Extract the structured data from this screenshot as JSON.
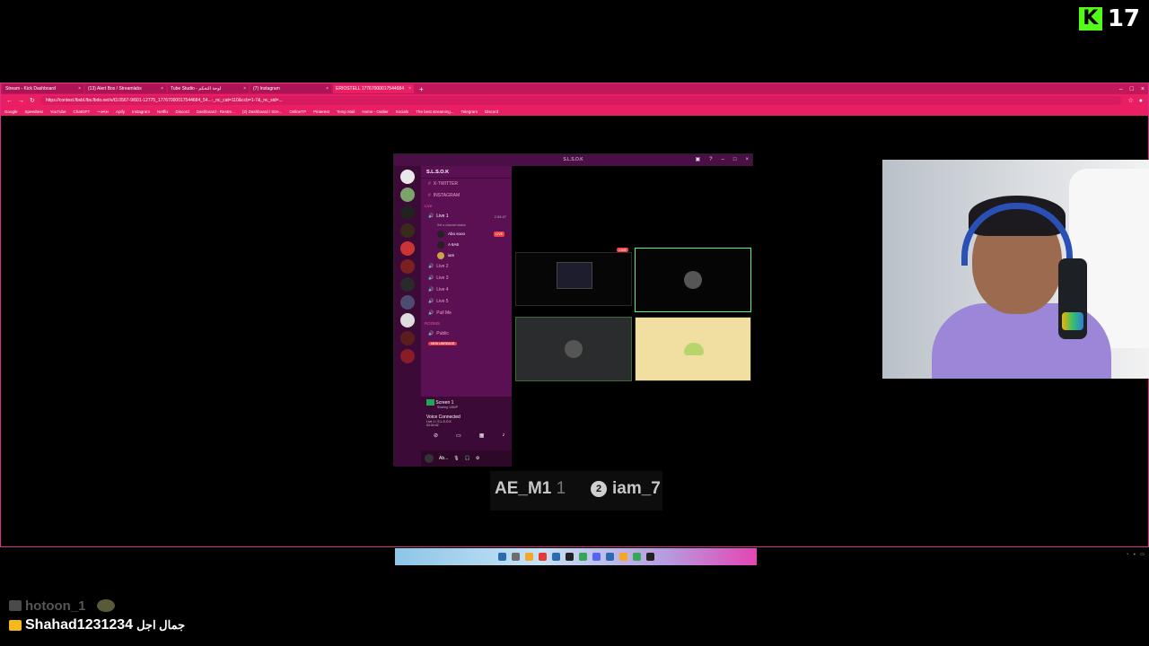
{
  "kick": {
    "logo": "K",
    "viewer_count": "17",
    "brand_color": "#53fc18"
  },
  "browser": {
    "tabs": [
      {
        "label": "Stream - Kick Dashboard",
        "active": false
      },
      {
        "label": "(13) Alert Box / Streamlabs",
        "active": false
      },
      {
        "label": "Tube Studio - لوحة التحكم",
        "active": false
      },
      {
        "label": "(7) Instagram",
        "active": false
      },
      {
        "label": "ERIOSTELL 17767000017544684",
        "active": true
      }
    ],
    "new_tab": "+",
    "url": "https://contest.fbsbl.fbs.fbdo.net/v/t3.0567-9/601-12775_17767000017544684_54...-_nc_cat=110&ccb=1-7&_nc_sid=...",
    "bookmarks": [
      "Google",
      "Speedtest",
      "YouTube",
      "ChatGPT",
      "يوتيوب",
      "Apify",
      "Instagram",
      "Netflix",
      "Discord",
      "Dashboard - Restre...",
      "(2) Dashboard / Stre...",
      "OnlineTP",
      "Pinterest",
      "Temp Mail",
      "Home - Outlier",
      "Socials",
      "The best streaming...",
      "Telegram",
      "Discord"
    ]
  },
  "discord": {
    "title": "S.L.S.O.K",
    "server_name": "S.L.S.O.K",
    "channels": [
      {
        "icon": "#",
        "label": "X-TWITTER"
      },
      {
        "icon": "#",
        "label": "INSTAGRAM"
      }
    ],
    "category_live": "Live",
    "voice_channel_active": {
      "label": "Live 1",
      "timer": "2:34:47",
      "status": "Set a channel status"
    },
    "voice_users": [
      {
        "name": "Abo sooo",
        "live": "LIVE"
      },
      {
        "name": "A   6A6"
      },
      {
        "name": "iam"
      }
    ],
    "voice_channels": [
      "Live 2",
      "Live 3",
      "Live 4",
      "Live 5"
    ],
    "pull_me": "Pull Me",
    "category_rooms": "ROOMS",
    "public": "Public",
    "new_unreads": "NEW UNREADS",
    "screen_label": "Screen 1",
    "screen_sub": "Sharing 1080P",
    "voice_connected": "Voice Connected",
    "voice_connected_sub": "Live 1 / S.L.S.O.K",
    "voice_connected_time": "02:34:42",
    "user_name": "Ab...",
    "tile_live": "LIVE"
  },
  "stream_names": {
    "first": "AE_M1",
    "first_num": "1",
    "second_badge": "2",
    "second": "iam_7"
  },
  "chat": [
    {
      "user": "hotoon_1",
      "faded": true,
      "message": ""
    },
    {
      "user": "Shahad1231234",
      "faded": false,
      "message": "جمال اجل"
    }
  ],
  "colors": {
    "browser_accent": "#e91e63",
    "discord_sidebar": "#5a1052",
    "voice_tile_border": "#57f287"
  }
}
